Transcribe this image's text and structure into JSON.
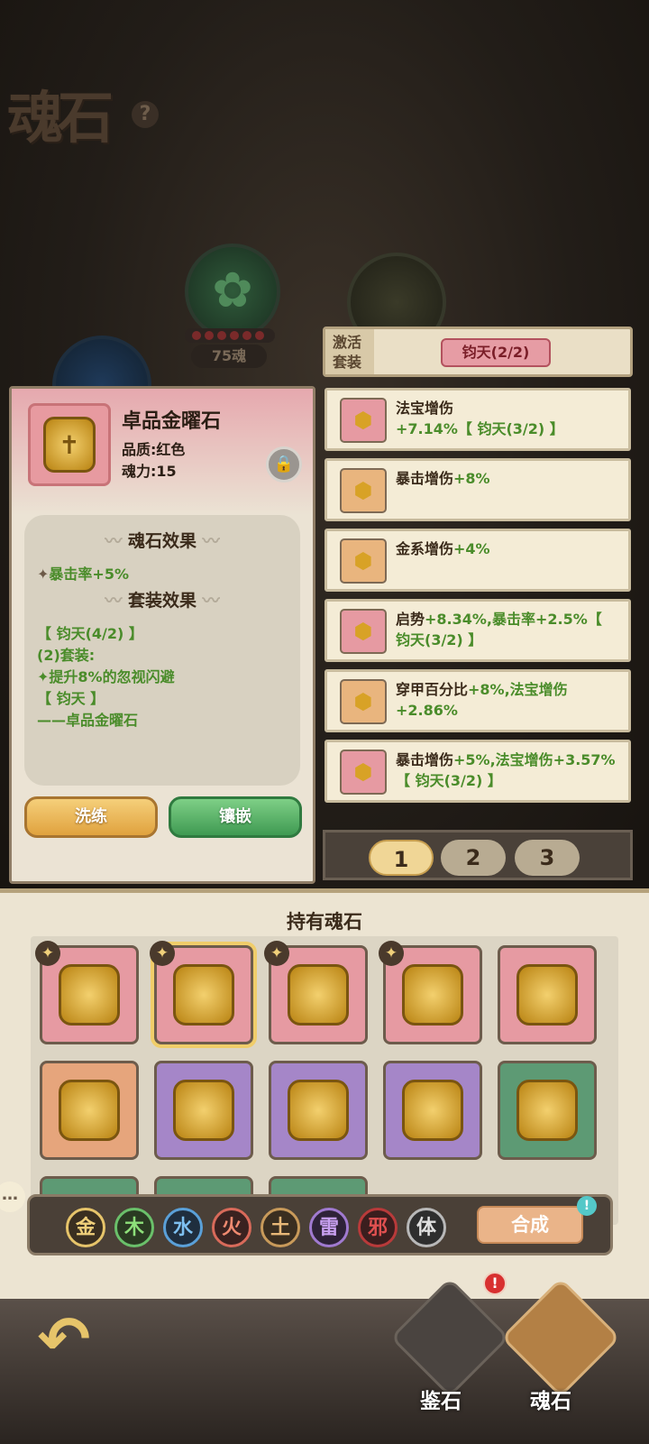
{
  "header": {
    "title": "魂石",
    "help_icon": "?"
  },
  "orbs": {
    "soul_count": "75魂"
  },
  "detail": {
    "name": "卓品金曜石",
    "quality": "品质:红色",
    "power": "魂力:15",
    "effect_heading": "魂石效果",
    "effect_bullet": "✦",
    "effect_stat": "暴击率",
    "effect_value": "+5%",
    "set_heading": "套装效果",
    "set_lines": [
      "【 钧天(4/2) 】",
      "(2)套装:",
      "✦提升8%的忽视闪避",
      "【 钧天 】",
      "——卓品金曜石"
    ],
    "refine_button": "洗练",
    "inlay_button": "镶嵌"
  },
  "activate": {
    "label_line1": "激活",
    "label_line2": "套装",
    "tag": "钧天(2/2)"
  },
  "stone_list": [
    {
      "color": "r",
      "text": "法宝增伤",
      "value": "+7.14%【 钧天(3/2) 】"
    },
    {
      "color": "o",
      "text": "暴击增伤",
      "value": "+8%"
    },
    {
      "color": "o",
      "text": "金系增伤",
      "value": "+4%"
    },
    {
      "color": "r",
      "text": "启势",
      "value": "+8.34%,暴击率+2.5%【 钧天(3/2) 】"
    },
    {
      "color": "o",
      "text": "穿甲百分比",
      "value": "+8%,法宝增伤+2.86%"
    },
    {
      "color": "r",
      "text": "暴击增伤",
      "value": "+5%,法宝增伤+3.57%【 钧天(3/2) 】"
    }
  ],
  "pager": [
    "1",
    "2",
    "3"
  ],
  "inventory": {
    "title": "持有魂石",
    "cells": [
      {
        "color": "r",
        "star": true,
        "selected": false
      },
      {
        "color": "r",
        "star": true,
        "selected": true
      },
      {
        "color": "r",
        "star": true,
        "selected": false
      },
      {
        "color": "r",
        "star": true,
        "selected": false
      },
      {
        "color": "r",
        "star": false,
        "selected": false
      },
      {
        "color": "o",
        "star": false,
        "selected": false
      },
      {
        "color": "p",
        "star": false,
        "selected": false
      },
      {
        "color": "p",
        "star": false,
        "selected": false
      },
      {
        "color": "p",
        "star": false,
        "selected": false
      },
      {
        "color": "g",
        "star": false,
        "selected": false
      },
      {
        "color": "g",
        "star": false,
        "selected": false
      },
      {
        "color": "g",
        "star": false,
        "selected": false
      },
      {
        "color": "g",
        "star": false,
        "selected": false
      }
    ]
  },
  "elements": [
    {
      "label": "金",
      "bg": "#3a2f20",
      "border": "#e6c46a",
      "color": "#f0d07a"
    },
    {
      "label": "木",
      "bg": "#2a3a22",
      "border": "#6ac06a",
      "color": "#8ee07a"
    },
    {
      "label": "水",
      "bg": "#1f2e3e",
      "border": "#5aa0d8",
      "color": "#7ec0f0"
    },
    {
      "label": "火",
      "bg": "#3a2220",
      "border": "#d86a5a",
      "color": "#f08a70"
    },
    {
      "label": "土",
      "bg": "#3a2e20",
      "border": "#c89a5a",
      "color": "#e8b878"
    },
    {
      "label": "雷",
      "bg": "#2e2238",
      "border": "#a07ad0",
      "color": "#c8a0f0"
    },
    {
      "label": "邪",
      "bg": "#3a1e1e",
      "border": "#b83a3a",
      "color": "#e05050"
    },
    {
      "label": "体",
      "bg": "#2e2e2e",
      "border": "#b8b8b8",
      "color": "#e0e0e0"
    }
  ],
  "merge_button": "合成",
  "merge_alert": "!",
  "nav": {
    "appraise": "鉴石",
    "soul": "魂石",
    "alert": "!"
  },
  "icons": {
    "stone": "stone-gem-icon",
    "lock": "lock-icon",
    "back": "back-arrow-icon",
    "chat": "chat-icon",
    "star": "star-icon"
  }
}
